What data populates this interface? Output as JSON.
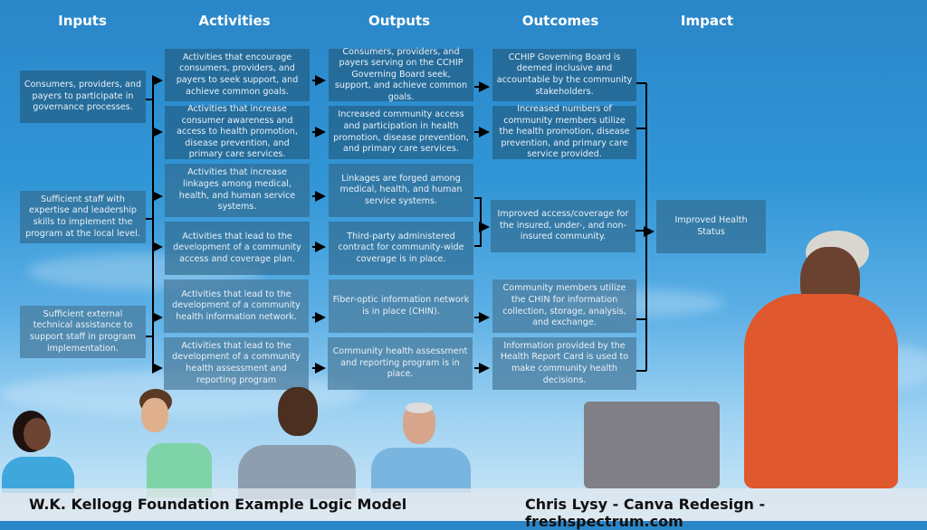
{
  "headers": {
    "inputs": "Inputs",
    "activities": "Activities",
    "outputs": "Outputs",
    "outcomes": "Outcomes",
    "impact": "Impact"
  },
  "inputs": [
    "Consumers, providers, and payers to participate in governance processes.",
    "Sufficient staff with expertise and leadership skills to implement the program at the local level.",
    "Sufficient external technical assistance to support staff in program implementation."
  ],
  "activities": [
    "Activities that encourage consumers, providers, and payers to seek support, and achieve common goals.",
    "Activities that increase consumer awareness and access to health promotion, disease prevention, and primary care services.",
    "Activities that increase linkages among medical, health, and human service systems.",
    "Activities that lead to the development of a community access and coverage plan.",
    "Activities that lead to the development of a community health information network.",
    "Activities that lead to the development of a community health assessment and reporting program"
  ],
  "outputs": [
    "Consumers, providers, and payers serving on the CCHIP Governing Board seek, support, and achieve common goals.",
    "Increased community access and participation in health promotion, disease prevention, and primary care services.",
    "Linkages are forged among medical, health, and human service systems.",
    "Third-party administered contract for community-wide coverage is in place.",
    "Fiber-optic information network is in place (CHIN).",
    "Community health assessment and reporting program is in place."
  ],
  "outcomes": [
    "CCHIP Governing Board is deemed inclusive and accountable by the community stakeholders.",
    "Increased numbers of community members utilize the health promotion, disease prevention, and primary care service provided.",
    "Improved access/coverage for the insured, under-, and non-insured community.",
    "Community members utilize the CHIN for information collection, storage, analysis, and exchange.",
    "Information provided by the Health Report Card is used to make community health decisions."
  ],
  "impact": "Improved Health Status",
  "footer": {
    "title": "W.K. Kellogg Foundation Example Logic Model",
    "credit": "Chris Lysy - Canva Redesign - freshspectrum.com"
  },
  "colors": {
    "box_fill": "#2f6a93",
    "connector": "#000000",
    "header_text": "#ffffff",
    "hoodie": "#e0582e"
  }
}
